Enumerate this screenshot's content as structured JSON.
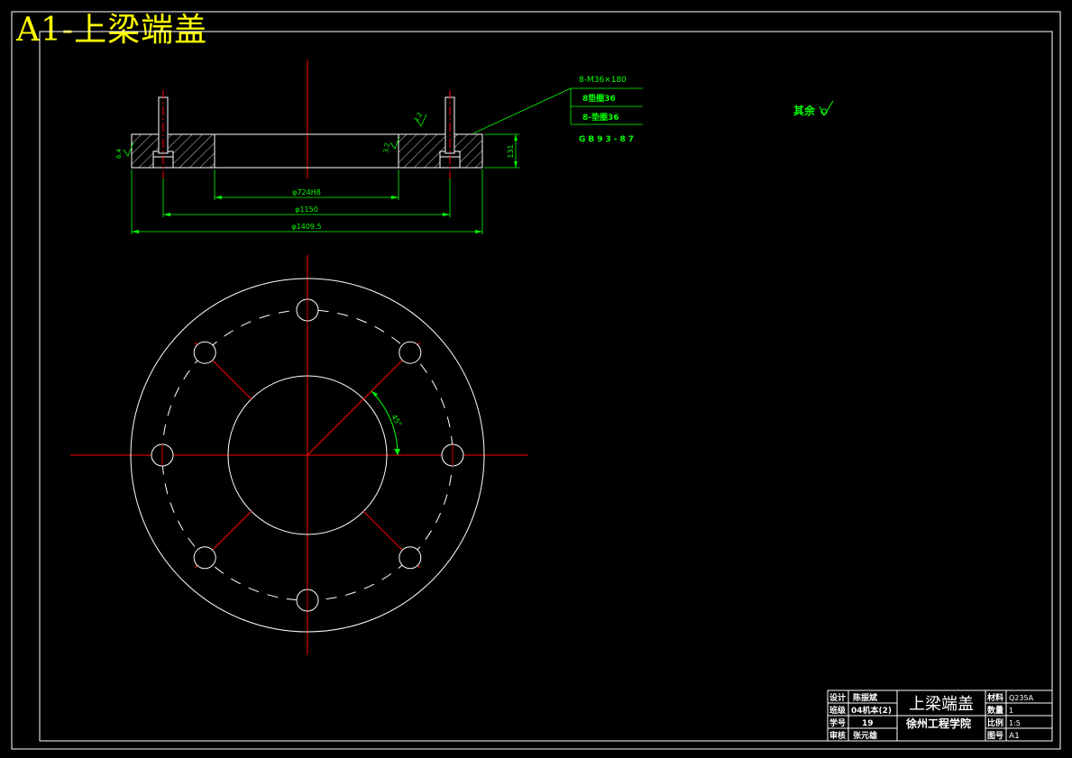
{
  "drawing_title": "A1-上梁端盖",
  "callout": {
    "bolt": "8-M36×180",
    "washer1": "8垫圈36",
    "washer2": "8-垫圈36",
    "standard": "GB93-87"
  },
  "surface_note": "其余",
  "roughness": {
    "left": "6.4",
    "top": "3.2",
    "inner": "3.2"
  },
  "dimensions": {
    "bore": "φ724H8",
    "bolt_circle": "φ1150",
    "outer": "φ1409.5",
    "thickness": "131",
    "angle": "45°"
  },
  "title_block": {
    "row1": {
      "label": "设计",
      "value": "陈振斌"
    },
    "row2": {
      "label": "班级",
      "value": "04机本(2)"
    },
    "row3": {
      "label": "学号",
      "value": "19"
    },
    "row4": {
      "label": "审核",
      "value": "张元雄"
    },
    "part_name": "上梁端盖",
    "school": "徐州工程学院",
    "material": {
      "label": "材料",
      "value": "Q235A"
    },
    "quantity": {
      "label": "数量",
      "value": "1"
    },
    "scale": {
      "label": "比例",
      "value": "1:5"
    },
    "drawing_no": {
      "label": "图号",
      "value": "A1"
    }
  },
  "colors": {
    "line": "#ffffff",
    "center": "#ff0000",
    "dimension": "#00ff00",
    "title": "#ffff00"
  }
}
